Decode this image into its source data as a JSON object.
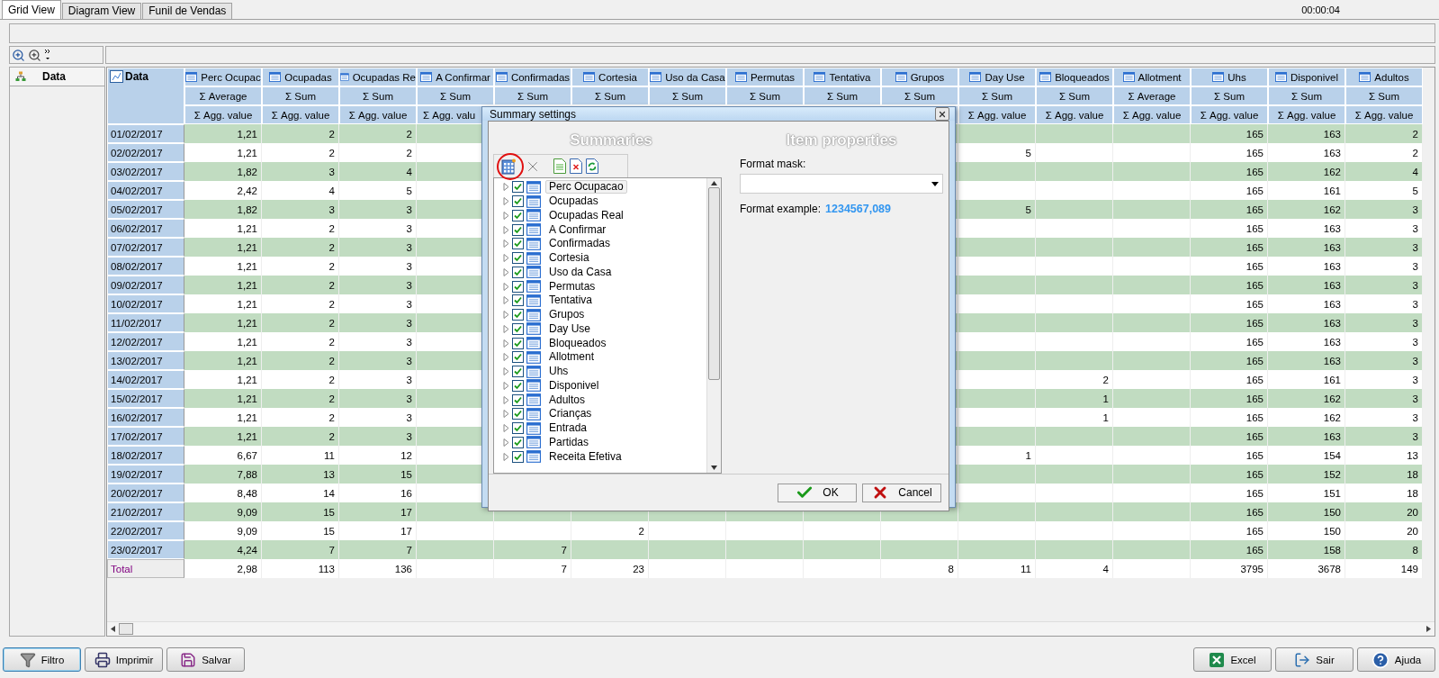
{
  "tabs": [
    {
      "label": "Grid View",
      "selected": true
    },
    {
      "label": "Diagram View",
      "selected": false
    },
    {
      "label": "Funil de Vendas",
      "selected": false
    }
  ],
  "timer": "00:00:04",
  "row_field": {
    "label": "Data"
  },
  "grid": {
    "corner_label": "Data",
    "columns": [
      {
        "label": "Perc Ocupac",
        "summary": "Σ Average",
        "agg": "Σ Agg. value"
      },
      {
        "label": "Ocupadas",
        "summary": "Σ Sum",
        "agg": "Σ Agg. value"
      },
      {
        "label": "Ocupadas Re",
        "summary": "Σ Sum",
        "agg": "Σ Agg. value"
      },
      {
        "label": "A Confirmar",
        "summary": "Σ Sum",
        "agg": "Σ Agg. valu"
      },
      {
        "label": "Confirmadas",
        "summary": "Σ Sum"
      },
      {
        "label": "Cortesia",
        "summary": "Σ Sum"
      },
      {
        "label": "Uso da Casa",
        "summary": "Σ Sum"
      },
      {
        "label": "Permutas",
        "summary": "Σ Sum"
      },
      {
        "label": "Tentativa",
        "summary": "Σ Sum"
      },
      {
        "label": "Grupos",
        "summary": "Σ Sum"
      },
      {
        "label": "Day Use",
        "summary": "Σ Sum",
        "agg": "Σ Agg. value"
      },
      {
        "label": "Bloqueados",
        "summary": "Σ Sum",
        "agg": "Σ Agg. value"
      },
      {
        "label": "Allotment",
        "summary": "Σ Average",
        "agg": "Σ Agg. value"
      },
      {
        "label": "Uhs",
        "summary": "Σ Sum",
        "agg": "Σ Agg. value"
      },
      {
        "label": "Disponivel",
        "summary": "Σ Sum",
        "agg": "Σ Agg. value"
      },
      {
        "label": "Adultos",
        "summary": "Σ Sum",
        "agg": "Σ Agg. value"
      }
    ],
    "rows": [
      {
        "label": "01/02/2017",
        "cells": [
          "1,21",
          "2",
          "2",
          null,
          null,
          null,
          null,
          null,
          null,
          null,
          null,
          null,
          null,
          "165",
          "163",
          "2"
        ]
      },
      {
        "label": "02/02/2017",
        "cells": [
          "1,21",
          "2",
          "2",
          null,
          null,
          null,
          null,
          null,
          null,
          null,
          "5",
          null,
          null,
          "165",
          "163",
          "2"
        ]
      },
      {
        "label": "03/02/2017",
        "cells": [
          "1,82",
          "3",
          "4",
          null,
          null,
          null,
          null,
          null,
          null,
          null,
          null,
          null,
          null,
          "165",
          "162",
          "4"
        ]
      },
      {
        "label": "04/02/2017",
        "cells": [
          "2,42",
          "4",
          "5",
          null,
          null,
          null,
          null,
          null,
          null,
          null,
          null,
          null,
          null,
          "165",
          "161",
          "5"
        ]
      },
      {
        "label": "05/02/2017",
        "cells": [
          "1,82",
          "3",
          "3",
          null,
          null,
          null,
          null,
          null,
          null,
          null,
          "5",
          null,
          null,
          "165",
          "162",
          "3"
        ]
      },
      {
        "label": "06/02/2017",
        "cells": [
          "1,21",
          "2",
          "3",
          null,
          null,
          null,
          null,
          null,
          null,
          null,
          null,
          null,
          null,
          "165",
          "163",
          "3"
        ]
      },
      {
        "label": "07/02/2017",
        "cells": [
          "1,21",
          "2",
          "3",
          null,
          null,
          null,
          null,
          null,
          null,
          null,
          null,
          null,
          null,
          "165",
          "163",
          "3"
        ]
      },
      {
        "label": "08/02/2017",
        "cells": [
          "1,21",
          "2",
          "3",
          null,
          null,
          null,
          null,
          null,
          null,
          null,
          null,
          null,
          null,
          "165",
          "163",
          "3"
        ]
      },
      {
        "label": "09/02/2017",
        "cells": [
          "1,21",
          "2",
          "3",
          null,
          null,
          null,
          null,
          null,
          null,
          null,
          null,
          null,
          null,
          "165",
          "163",
          "3"
        ]
      },
      {
        "label": "10/02/2017",
        "cells": [
          "1,21",
          "2",
          "3",
          null,
          null,
          null,
          null,
          null,
          null,
          null,
          null,
          null,
          null,
          "165",
          "163",
          "3"
        ]
      },
      {
        "label": "11/02/2017",
        "cells": [
          "1,21",
          "2",
          "3",
          null,
          null,
          null,
          null,
          null,
          null,
          null,
          null,
          null,
          null,
          "165",
          "163",
          "3"
        ]
      },
      {
        "label": "12/02/2017",
        "cells": [
          "1,21",
          "2",
          "3",
          null,
          null,
          null,
          null,
          null,
          null,
          null,
          null,
          null,
          null,
          "165",
          "163",
          "3"
        ]
      },
      {
        "label": "13/02/2017",
        "cells": [
          "1,21",
          "2",
          "3",
          null,
          null,
          null,
          null,
          null,
          null,
          null,
          null,
          null,
          null,
          "165",
          "163",
          "3"
        ]
      },
      {
        "label": "14/02/2017",
        "cells": [
          "1,21",
          "2",
          "3",
          null,
          null,
          null,
          null,
          null,
          null,
          null,
          null,
          "2",
          null,
          "165",
          "161",
          "3"
        ]
      },
      {
        "label": "15/02/2017",
        "cells": [
          "1,21",
          "2",
          "3",
          null,
          null,
          null,
          null,
          null,
          null,
          null,
          null,
          "1",
          null,
          "165",
          "162",
          "3"
        ]
      },
      {
        "label": "16/02/2017",
        "cells": [
          "1,21",
          "2",
          "3",
          null,
          null,
          null,
          null,
          null,
          null,
          null,
          null,
          "1",
          null,
          "165",
          "162",
          "3"
        ]
      },
      {
        "label": "17/02/2017",
        "cells": [
          "1,21",
          "2",
          "3",
          null,
          null,
          null,
          null,
          null,
          null,
          null,
          null,
          null,
          null,
          "165",
          "163",
          "3"
        ]
      },
      {
        "label": "18/02/2017",
        "cells": [
          "6,67",
          "11",
          "12",
          null,
          null,
          null,
          null,
          null,
          null,
          null,
          "1",
          null,
          null,
          "165",
          "154",
          "13"
        ]
      },
      {
        "label": "19/02/2017",
        "cells": [
          "7,88",
          "13",
          "15",
          null,
          null,
          null,
          null,
          null,
          null,
          null,
          null,
          null,
          null,
          "165",
          "152",
          "18"
        ]
      },
      {
        "label": "20/02/2017",
        "cells": [
          "8,48",
          "14",
          "16",
          null,
          null,
          null,
          null,
          null,
          null,
          null,
          null,
          null,
          null,
          "165",
          "151",
          "18"
        ]
      },
      {
        "label": "21/02/2017",
        "cells": [
          "9,09",
          "15",
          "17",
          null,
          null,
          null,
          null,
          null,
          null,
          null,
          null,
          null,
          null,
          "165",
          "150",
          "20"
        ]
      },
      {
        "label": "22/02/2017",
        "cells": [
          "9,09",
          "15",
          "17",
          null,
          null,
          "2",
          null,
          null,
          null,
          null,
          null,
          null,
          null,
          "165",
          "150",
          "20"
        ]
      },
      {
        "label": "23/02/2017",
        "cells": [
          "4,24",
          "7",
          "7",
          null,
          "7",
          null,
          null,
          null,
          null,
          null,
          null,
          null,
          null,
          "165",
          "158",
          "8"
        ]
      }
    ],
    "total": {
      "label": "Total",
      "cells": [
        "2,98",
        "113",
        "136",
        null,
        "7",
        "23",
        null,
        null,
        null,
        "8",
        "11",
        "4",
        null,
        "3795",
        "3678",
        "149"
      ]
    }
  },
  "dialog": {
    "title": "Summary settings",
    "left_heading": "Summaries",
    "right_heading": "Item properties",
    "items": [
      {
        "label": "Perc Ocupacao",
        "checked": true,
        "selected": true
      },
      {
        "label": "Ocupadas",
        "checked": true,
        "selected": false
      },
      {
        "label": "Ocupadas Real",
        "checked": true,
        "selected": false
      },
      {
        "label": "A Confirmar",
        "checked": true,
        "selected": false
      },
      {
        "label": "Confirmadas",
        "checked": true,
        "selected": false
      },
      {
        "label": "Cortesia",
        "checked": true,
        "selected": false
      },
      {
        "label": "Uso da Casa",
        "checked": true,
        "selected": false
      },
      {
        "label": "Permutas",
        "checked": true,
        "selected": false
      },
      {
        "label": "Tentativa",
        "checked": true,
        "selected": false
      },
      {
        "label": "Grupos",
        "checked": true,
        "selected": false
      },
      {
        "label": "Day Use",
        "checked": true,
        "selected": false
      },
      {
        "label": "Bloqueados",
        "checked": true,
        "selected": false
      },
      {
        "label": "Allotment",
        "checked": true,
        "selected": false
      },
      {
        "label": "Uhs",
        "checked": true,
        "selected": false
      },
      {
        "label": "Disponivel",
        "checked": true,
        "selected": false
      },
      {
        "label": "Adultos",
        "checked": true,
        "selected": false
      },
      {
        "label": "Crianças",
        "checked": true,
        "selected": false
      },
      {
        "label": "Entrada",
        "checked": true,
        "selected": false
      },
      {
        "label": "Partidas",
        "checked": true,
        "selected": false
      },
      {
        "label": "Receita Efetiva",
        "checked": true,
        "selected": false
      }
    ],
    "format_mask_label": "Format mask:",
    "format_example_label": "Format example:",
    "format_example": "1234567,089",
    "buttons": [
      {
        "label": "OK",
        "kind": "ok"
      },
      {
        "label": "Cancel",
        "kind": "cancel"
      }
    ]
  },
  "footer": {
    "left": [
      {
        "label": "Filtro",
        "kind": "filter",
        "focused": true
      },
      {
        "label": "Imprimir",
        "kind": "print",
        "focused": false
      },
      {
        "label": "Salvar",
        "kind": "save",
        "focused": false
      }
    ],
    "right": [
      {
        "label": "Excel",
        "kind": "excel",
        "focused": false
      },
      {
        "label": "Sair",
        "kind": "exit",
        "focused": false
      },
      {
        "label": "Ajuda",
        "kind": "help",
        "focused": false
      }
    ]
  }
}
